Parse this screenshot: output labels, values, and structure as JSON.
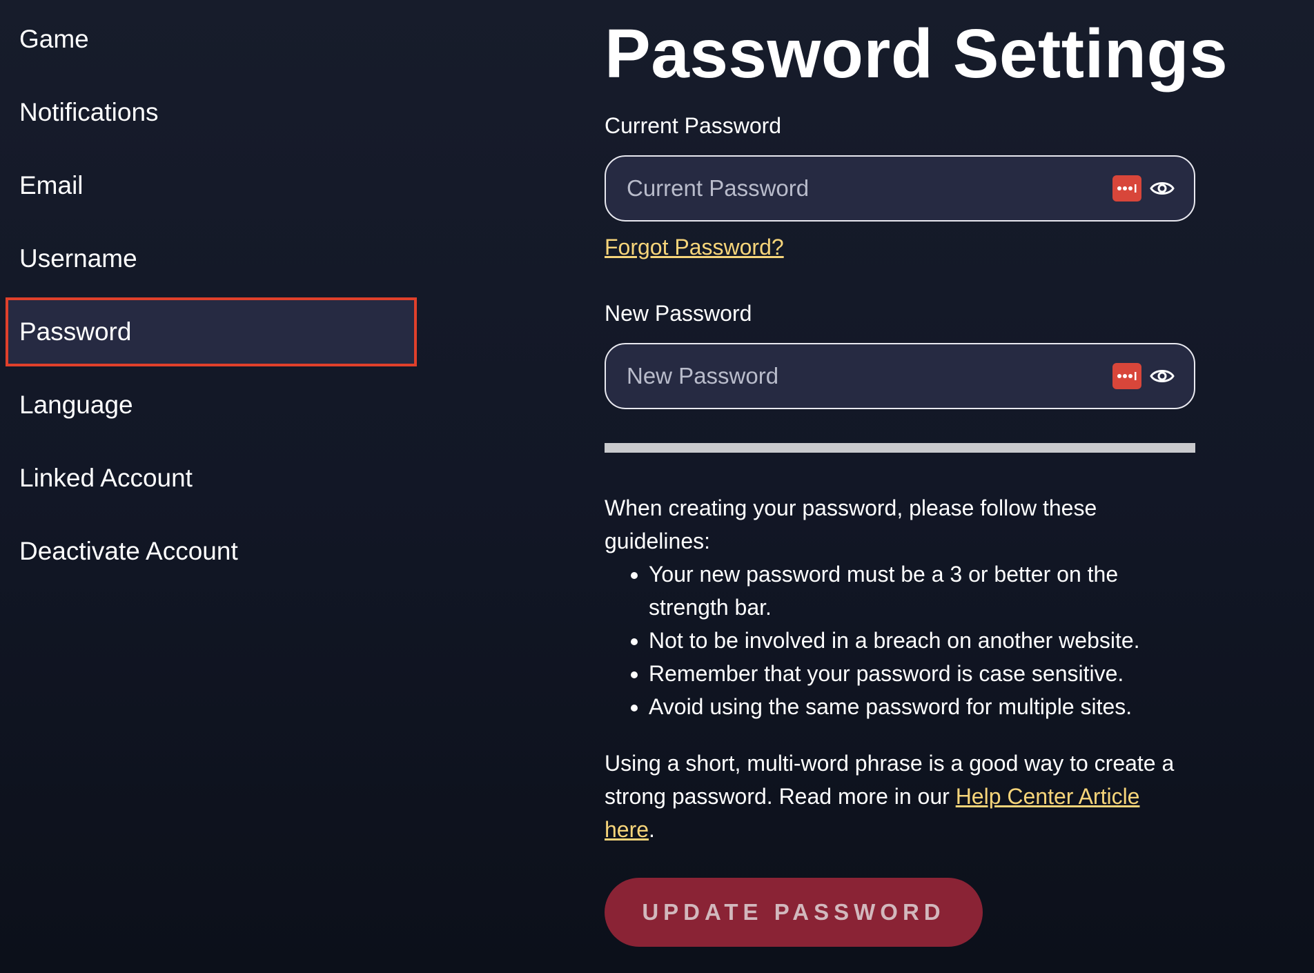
{
  "sidebar": {
    "items": [
      {
        "label": "Game"
      },
      {
        "label": "Notifications"
      },
      {
        "label": "Email"
      },
      {
        "label": "Username"
      },
      {
        "label": "Password",
        "active": true
      },
      {
        "label": "Language"
      },
      {
        "label": "Linked Account"
      },
      {
        "label": "Deactivate Account"
      }
    ]
  },
  "main": {
    "title": "Password Settings",
    "current_password": {
      "label": "Current Password",
      "placeholder": "Current Password",
      "value": ""
    },
    "forgot_link": "Forgot Password?",
    "new_password": {
      "label": "New Password",
      "placeholder": "New Password",
      "value": ""
    },
    "strength": {
      "level": 0
    },
    "guidelines": {
      "intro": "When creating your password, please follow these guidelines:",
      "items": [
        "Your new password must be a 3 or better on the strength bar.",
        "Not to be involved in a breach on another website.",
        "Remember that your password is case sensitive.",
        "Avoid using the same password for multiple sites."
      ]
    },
    "tip": {
      "before": "Using a short, multi-word phrase is a good way to create a strong password. Read more in our ",
      "link": "Help Center Article here",
      "after": "."
    },
    "update_button": "UPDATE PASSWORD"
  },
  "icons": {
    "password_manager": "password-manager-icon",
    "visibility": "eye-icon"
  },
  "colors": {
    "background": "#121726",
    "active_nav_bg": "#262a42",
    "active_nav_border": "#e0402b",
    "link": "#f7d57a",
    "button_bg": "#8a2335",
    "button_text": "#d2b8bd",
    "password_manager_icon": "#d8463a",
    "strength_bar": "#c9cacd"
  }
}
